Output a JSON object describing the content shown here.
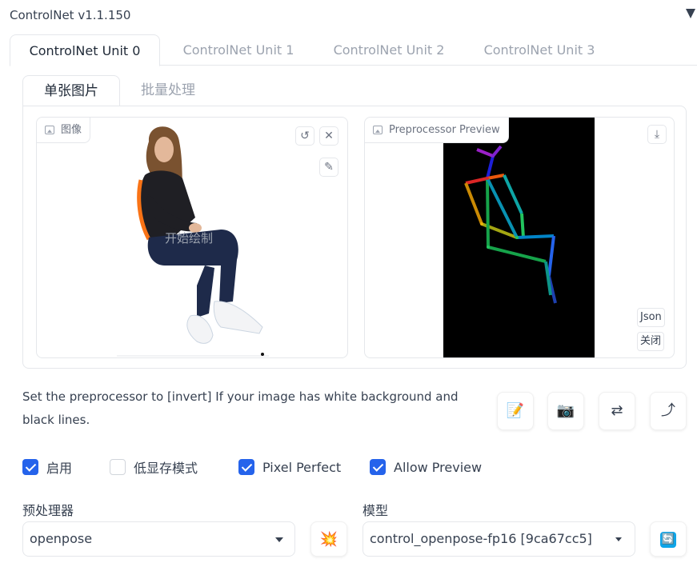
{
  "header": {
    "title": "ControlNet v1.1.150"
  },
  "unit_tabs": [
    "ControlNet Unit 0",
    "ControlNet Unit 1",
    "ControlNet Unit 2",
    "ControlNet Unit 3"
  ],
  "mode_tabs": [
    "单张图片",
    "批量处理"
  ],
  "image_box": {
    "label": "图像",
    "draw_hint": "开始绘制"
  },
  "preview_box": {
    "label": "Preprocessor Preview",
    "json_button": "Json",
    "close_button": "关闭"
  },
  "hint": "Set the preprocessor to [invert] If your image has white background and black lines.",
  "tool_buttons": [
    "📝",
    "📷",
    "⇄",
    "⤴"
  ],
  "checkboxes": [
    {
      "label": "启用",
      "checked": true
    },
    {
      "label": "低显存模式",
      "checked": false
    },
    {
      "label": "Pixel Perfect",
      "checked": true
    },
    {
      "label": "Allow Preview",
      "checked": true
    }
  ],
  "preprocessor": {
    "label": "预处理器",
    "value": "openpose"
  },
  "model": {
    "label": "模型",
    "value": "control_openpose-fp16 [9ca67cc5]"
  },
  "colors": {
    "accent": "#2563eb",
    "border": "#e5e7eb",
    "muted": "#9ca3af"
  }
}
